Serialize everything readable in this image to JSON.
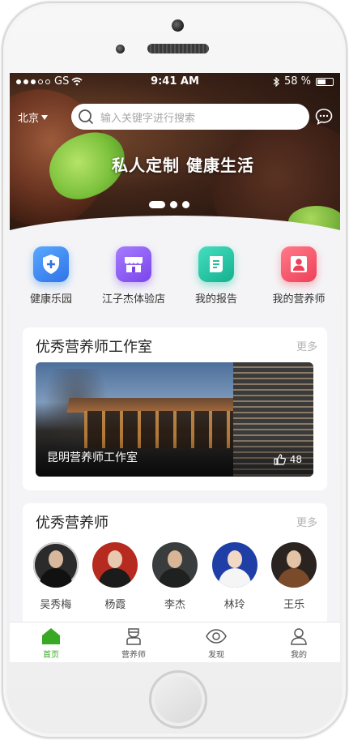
{
  "status_bar": {
    "carrier": "GS",
    "time": "9:41 AM",
    "battery": "58 %",
    "battery_level": 0.58
  },
  "header": {
    "city": "北京",
    "search_placeholder": "输入关键字进行搜索"
  },
  "banner": {
    "slogan": "私人定制  健康生活",
    "pages": 3,
    "active_page": 1
  },
  "quick_entries": [
    {
      "label": "健康乐园",
      "icon": "shield-plus-icon",
      "color": "#3f8ef0"
    },
    {
      "label": "江子杰体验店",
      "icon": "store-icon",
      "color": "#8f5bf2"
    },
    {
      "label": "我的报告",
      "icon": "report-icon",
      "color": "#21c6a6"
    },
    {
      "label": "我的营养师",
      "icon": "person-icon",
      "color": "#f45b6d"
    }
  ],
  "studios_section": {
    "title": "优秀营养师工作室",
    "more": "更多",
    "studio": {
      "name": "昆明营养师工作室",
      "likes": "48"
    }
  },
  "nutritionists_section": {
    "title": "优秀营养师",
    "more": "更多",
    "people": [
      {
        "name": "吴秀梅"
      },
      {
        "name": "杨霞"
      },
      {
        "name": "李杰"
      },
      {
        "name": "林玲"
      },
      {
        "name": "王乐"
      }
    ]
  },
  "tabbar": {
    "accent": "#39a924",
    "tabs": [
      {
        "label": "首页",
        "icon": "home-icon",
        "active": true
      },
      {
        "label": "营养师",
        "icon": "nutritionist-icon",
        "active": false
      },
      {
        "label": "发现",
        "icon": "eye-icon",
        "active": false
      },
      {
        "label": "我的",
        "icon": "user-icon",
        "active": false
      }
    ]
  }
}
